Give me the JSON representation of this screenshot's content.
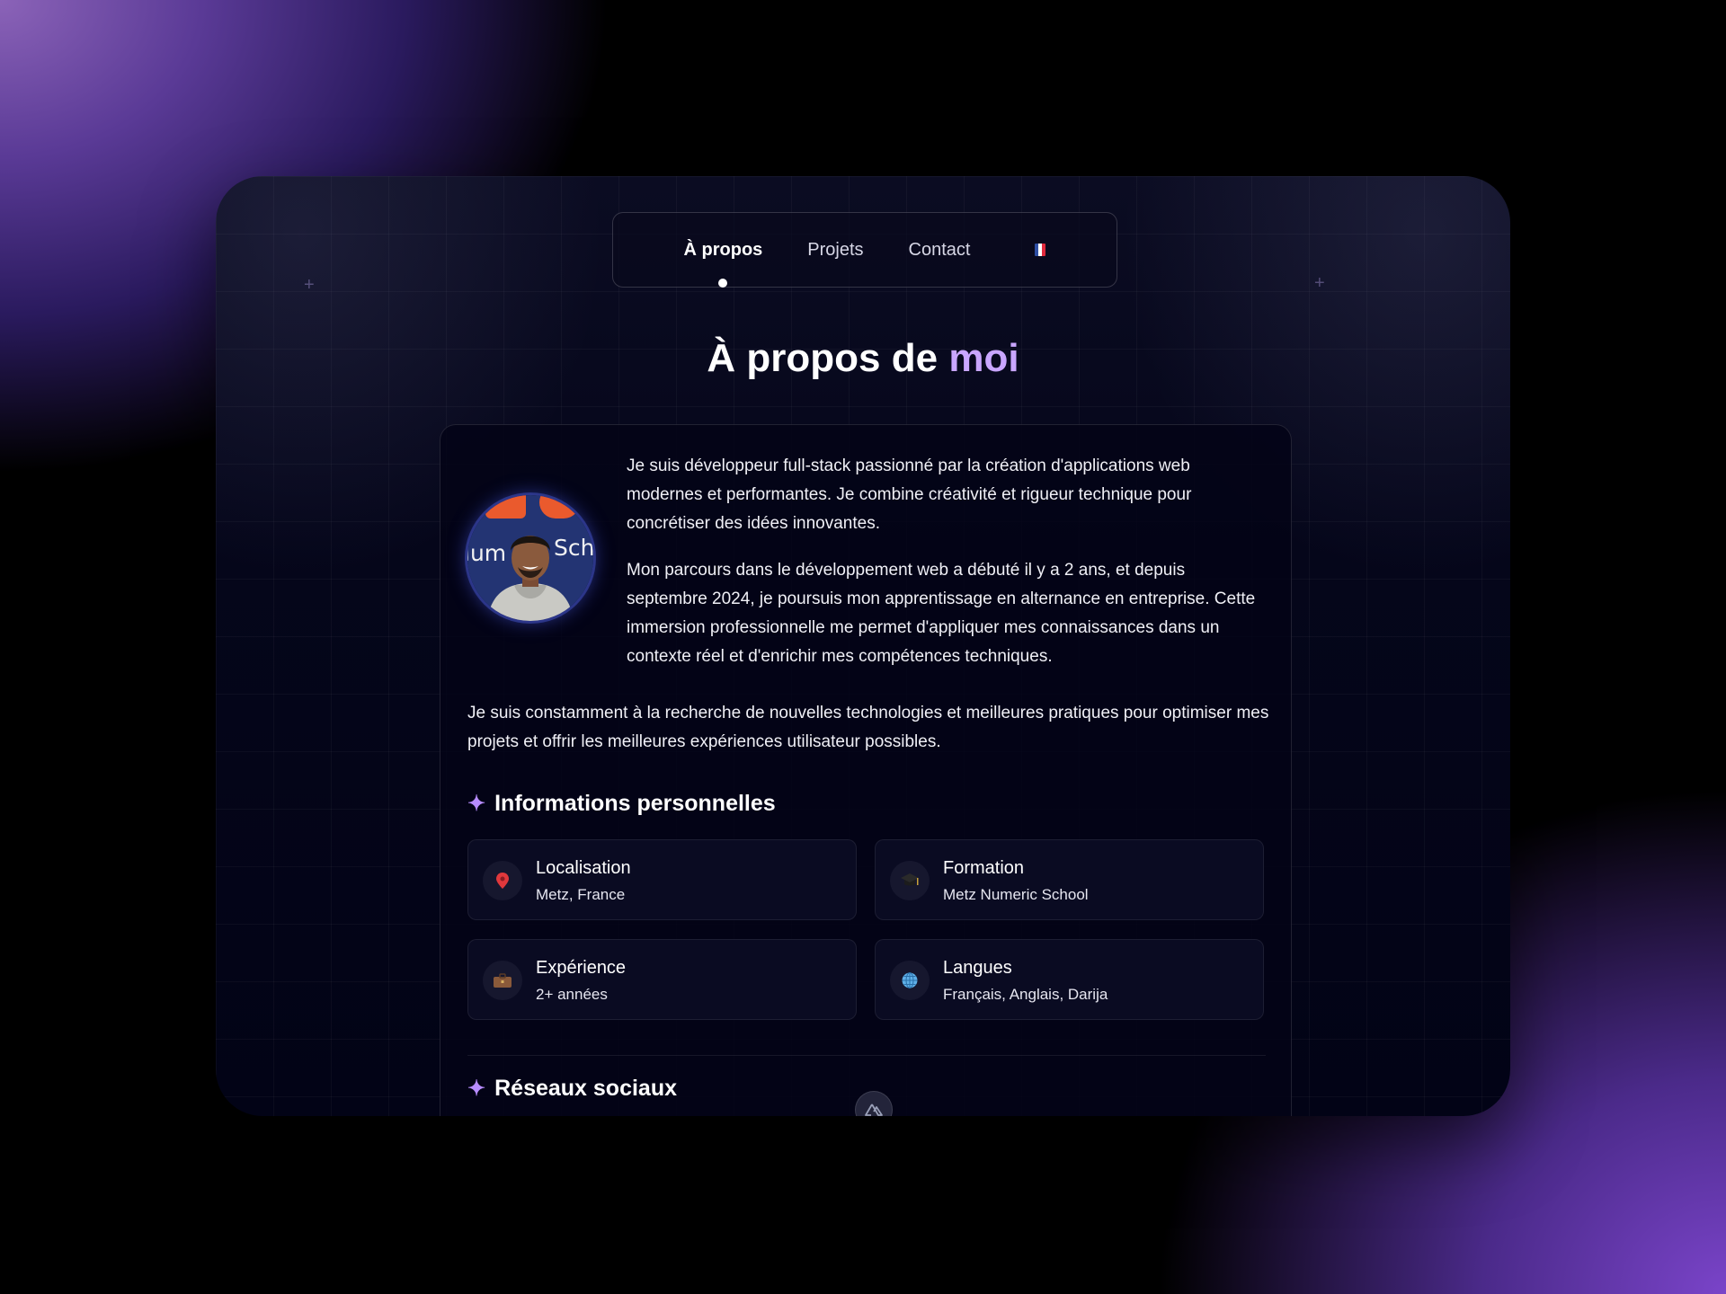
{
  "nav": {
    "items": [
      {
        "label": "À propos",
        "active": true
      },
      {
        "label": "Projets",
        "active": false
      },
      {
        "label": "Contact",
        "active": false
      }
    ],
    "language_flag": "french-flag-icon",
    "flag_colors": [
      "#2e4ea3",
      "#ffffff",
      "#e0283c"
    ]
  },
  "heading": {
    "main": "À propos de",
    "accent": "moi"
  },
  "colors": {
    "accent": "#c9a6ff",
    "star": "#b78cff"
  },
  "about": {
    "avatar_icon": "profile-photo",
    "paragraph_1": "Je suis développeur full-stack passionné par la création d'applications web modernes et performantes. Je combine créativité et rigueur technique pour concrétiser des idées innovantes.",
    "paragraph_2": "Mon parcours dans le développement web a débuté il y a 2 ans, et depuis septembre 2024, je poursuis mon apprentissage en alternance en entreprise. Cette immersion professionnelle me permet d'appliquer mes connaissances dans un contexte réel et d'enrichir mes compétences techniques.",
    "paragraph_3": "Je suis constamment à la recherche de nouvelles technologies et meilleures pratiques pour optimiser mes projets et offrir les meilleures expériences utilisateur possibles."
  },
  "personal_info": {
    "title": "Informations personnelles",
    "items": [
      {
        "icon": "location-pin-icon",
        "label": "Localisation",
        "value": "Metz, France"
      },
      {
        "icon": "graduation-cap-icon",
        "label": "Formation",
        "value": "Metz Numeric School"
      },
      {
        "icon": "briefcase-icon",
        "label": "Expérience",
        "value": "2+ années"
      },
      {
        "icon": "globe-icon",
        "label": "Langues",
        "value": "Français, Anglais, Darija"
      }
    ]
  },
  "social": {
    "title": "Réseaux sociaux"
  },
  "floating_button_icon": "nuxt-icon"
}
